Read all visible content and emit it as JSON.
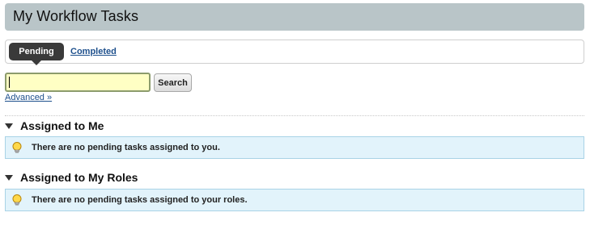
{
  "header": {
    "title": "My Workflow Tasks"
  },
  "tabs": [
    {
      "label": "Pending",
      "active": true
    },
    {
      "label": "Completed",
      "active": false
    }
  ],
  "search": {
    "value": "",
    "button_label": "Search",
    "advanced_label": "Advanced »"
  },
  "sections": [
    {
      "title": "Assigned to Me",
      "message": "There are no pending tasks assigned to you.",
      "icon": "lightbulb-icon"
    },
    {
      "title": "Assigned to My Roles",
      "message": "There are no pending tasks assigned to your roles.",
      "icon": "lightbulb-icon"
    }
  ],
  "colors": {
    "title_bar": "#b9c5c8",
    "active_tab": "#3a3a3a",
    "link": "#1d4f8c",
    "search_input_bg": "#ffffc4",
    "info_bg": "#e2f3fb",
    "info_border": "#a9d3e6"
  }
}
